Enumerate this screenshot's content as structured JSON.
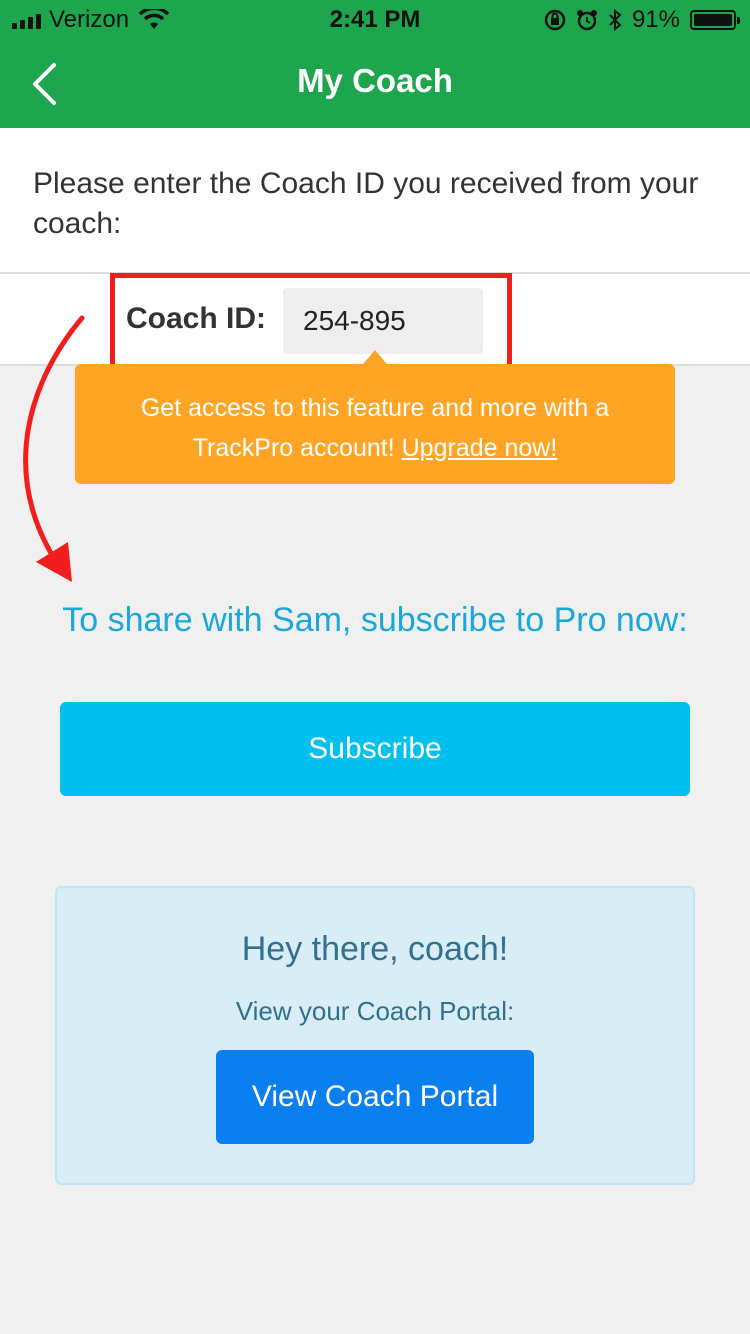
{
  "status_bar": {
    "carrier": "Verizon",
    "time": "2:41 PM",
    "battery_percent": "91%"
  },
  "nav": {
    "title": "My Coach",
    "back_icon": "chevron-left-icon"
  },
  "instruction": {
    "text": "Please enter the Coach ID you received from your coach:"
  },
  "coach_id": {
    "label": "Coach ID:",
    "value": "254-895"
  },
  "upgrade_tooltip": {
    "text": "Get access to this feature and more with a TrackPro account!",
    "link": "Upgrade now!"
  },
  "share": {
    "heading": "To share with Sam, subscribe to Pro now:",
    "button": "Subscribe"
  },
  "coach_panel": {
    "title": "Hey there, coach!",
    "subtitle": "View your Coach Portal:",
    "button": "View Coach Portal"
  },
  "colors": {
    "header_green": "#1ea64e",
    "tooltip_orange": "#ffa525",
    "subscribe_cyan": "#00c0ef",
    "portal_blue": "#0a7ff0",
    "panel_bg": "#d9edf7",
    "highlight_red": "#f21d1d"
  }
}
